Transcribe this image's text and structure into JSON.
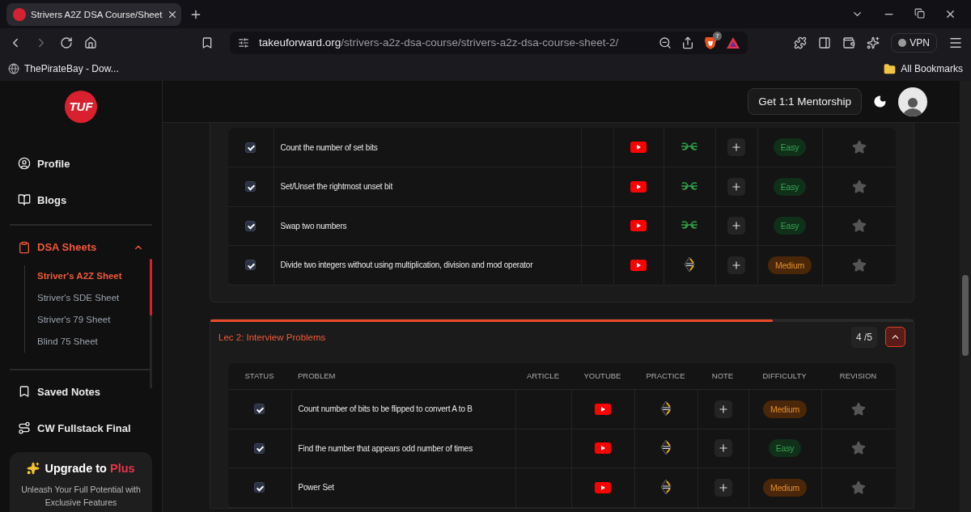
{
  "browser": {
    "tabs": [
      {
        "title": "Strivers A2Z DSA Course/Sheet",
        "selected": true
      }
    ],
    "url": {
      "domain": "takeuforward.org",
      "path": "/strivers-a2z-dsa-course/strivers-a2z-dsa-course-sheet-2/"
    },
    "shield_badge": "7",
    "vpn": "VPN",
    "bookmarks": [
      {
        "label": "ThePirateBay - Dow..."
      }
    ],
    "all_bookmarks": "All Bookmarks"
  },
  "sidebar": {
    "logo": "TUF",
    "items": [
      {
        "label": "Profile",
        "kind": "profile",
        "selected": false
      },
      {
        "label": "Blogs",
        "kind": "blogs",
        "selected": false
      },
      {
        "label": "DSA Sheets",
        "kind": "sheets",
        "selected": true,
        "expanded": true,
        "children": [
          {
            "label": "Striver's A2Z Sheet",
            "selected": true
          },
          {
            "label": "Striver's SDE Sheet",
            "selected": false
          },
          {
            "label": "Striver's 79 Sheet",
            "selected": false
          },
          {
            "label": "Blind 75 Sheet",
            "selected": false
          }
        ]
      },
      {
        "label": "Saved Notes",
        "kind": "notes",
        "selected": false
      },
      {
        "label": "CW Fullstack Final",
        "kind": "route",
        "selected": false
      }
    ],
    "upgrade": {
      "title": "Upgrade to **Plus**",
      "text": "Unleash Your Full Potential with Exclusive Features"
    }
  },
  "header": {
    "mentorship_button": "Get 1:1 Mentorship"
  },
  "sections": [
    {
      "rows": [
        {
          "checked": true,
          "problem": "Count the number of set bits",
          "kind": "gfg",
          "difficulty": "Easy",
          "starred": false
        },
        {
          "checked": true,
          "problem": "Set/Unset the rightmost unset bit",
          "kind": "gfg",
          "difficulty": "Easy",
          "starred": false
        },
        {
          "checked": true,
          "problem": "Swap two numbers",
          "kind": "gfg",
          "difficulty": "Easy",
          "starred": false
        },
        {
          "checked": true,
          "problem": "Divide two integers without using multiplication, division and mod operator",
          "kind": "codestudio",
          "difficulty": "Medium",
          "starred": false
        }
      ]
    },
    {
      "title": "Lec 2: Interview Problems",
      "count": "4 /5",
      "level": 0.8,
      "expanded": true,
      "columns": [
        "STATUS",
        "PROBLEM",
        "ARTICLE",
        "YOUTUBE",
        "PRACTICE",
        "NOTE",
        "DIFFICULTY",
        "REVISION"
      ],
      "rows": [
        {
          "checked": true,
          "problem": "Count number of bits to be flipped to convert A to B",
          "kind": "codestudio",
          "difficulty": "Medium",
          "starred": false
        },
        {
          "checked": true,
          "problem": "Find the number that appears odd number of times",
          "kind": "codestudio",
          "difficulty": "Easy",
          "starred": false
        },
        {
          "checked": true,
          "problem": "Power Set",
          "kind": "codestudio",
          "difficulty": "Medium",
          "starred": false
        }
      ]
    }
  ]
}
